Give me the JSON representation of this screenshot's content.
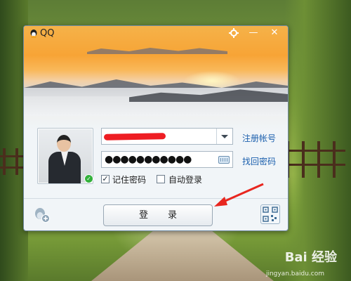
{
  "window": {
    "title": "QQ",
    "settings_icon": "gear-icon",
    "minimize_icon": "minimize-icon",
    "minimize_glyph": "—",
    "close_icon": "close-icon",
    "close_glyph": "✕"
  },
  "login_form": {
    "account_value": "",
    "account_dropdown_icon": "chevron-down-icon",
    "password_dots": "●●●●●●●●●●●",
    "keyboard_icon": "soft-keyboard-icon",
    "register_link": "注册帐号",
    "recover_link": "找回密码",
    "remember_password_label": "记住密码",
    "remember_password_checked": true,
    "auto_login_label": "自动登录",
    "auto_login_checked": false,
    "checkmark_glyph": "✓",
    "login_button": "登录",
    "multi_account_icon": "add-account-icon",
    "qr_icon": "qr-code-icon",
    "online_status_glyph": "✓"
  },
  "colors": {
    "accent_link": "#1b5fad",
    "redaction": "#ee1d23",
    "annotation_arrow": "#e8261f",
    "online_status": "#33b13b"
  },
  "watermark": {
    "brand": "Bai 经验",
    "url": "jingyan.baidu.com"
  }
}
